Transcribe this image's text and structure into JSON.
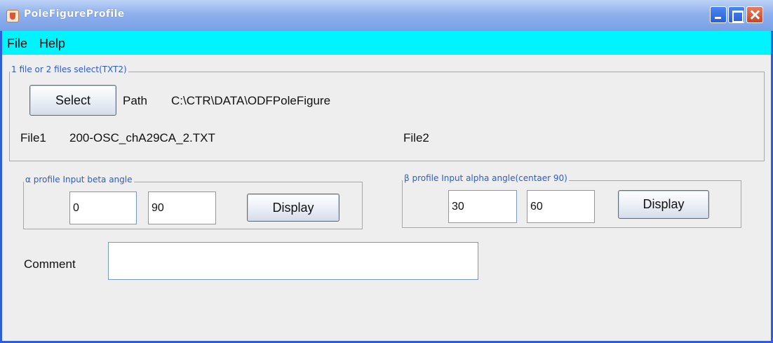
{
  "window": {
    "title": "PoleFigureProfile",
    "controls": [
      "minimize-icon",
      "maximize-icon",
      "close-icon"
    ]
  },
  "menu": {
    "items": [
      "File",
      "Help"
    ]
  },
  "file_group": {
    "legend": "1 file or 2 files select(TXT2)",
    "select_button": "Select",
    "path_label": "Path",
    "path_value": "C:\\CTR\\DATA\\ODFPoleFigure",
    "file1_label": "File1",
    "file1_value": "200-OSC_chA29CA_2.TXT",
    "file2_label": "File2",
    "file2_value": ""
  },
  "alpha_group": {
    "legend": "α profile Input beta angle",
    "input1": "0",
    "input2": "90",
    "display_button": "Display"
  },
  "beta_group": {
    "legend": "β profile Input alpha angle(centaer 90)",
    "input1": "30",
    "input2": "60",
    "display_button": "Display"
  },
  "comment": {
    "label": "Comment",
    "value": ""
  },
  "colors": {
    "menubar": "#00f4ff",
    "titlebar": "#7a9fe6",
    "legend_text": "#2c5cc8"
  }
}
